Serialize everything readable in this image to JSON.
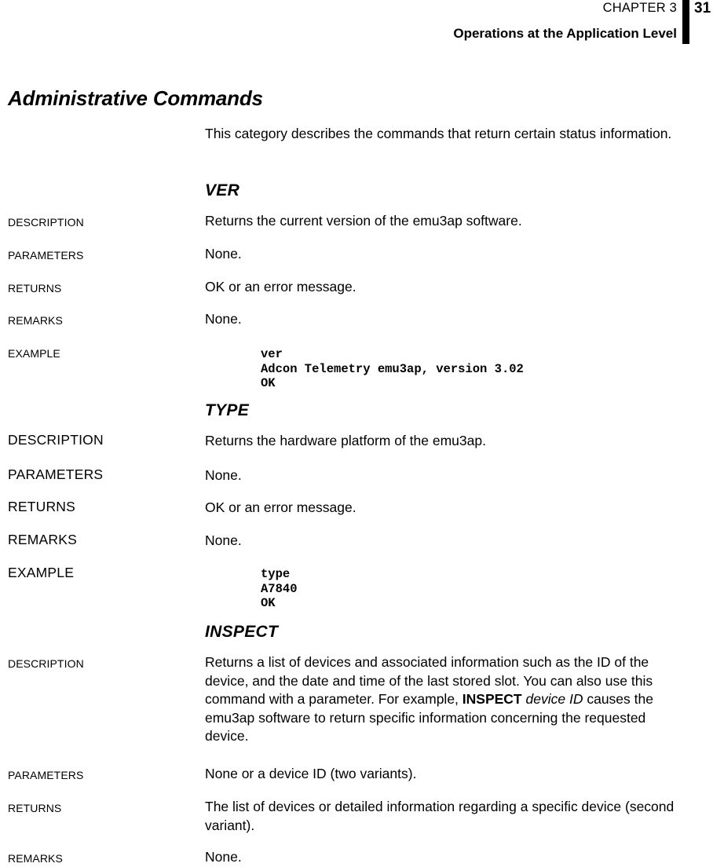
{
  "header": {
    "chapter_label": "CHAPTER 3",
    "page_number": "31",
    "running_title": "Operations at the Application Level"
  },
  "section": {
    "title": "Administrative Commands",
    "intro": "This category describes the commands that return certain status information."
  },
  "commands": [
    {
      "name": "VER",
      "labels": {
        "description": "DESCRIPTION",
        "parameters": "PARAMETERS",
        "returns": "RETURNS",
        "remarks": "REMARKS",
        "example": "EXAMPLE"
      },
      "description": "Returns the current version of the emu3ap software.",
      "parameters": "None.",
      "returns": "OK or an error message.",
      "remarks": "None.",
      "example": "ver\nAdcon Telemetry emu3ap, version 3.02\nOK"
    },
    {
      "name": "TYPE",
      "labels": {
        "description": "DESCRIPTION",
        "parameters": "PARAMETERS",
        "returns": "RETURNS",
        "remarks": "REMARKS",
        "example": "EXAMPLE"
      },
      "description": "Returns the hardware platform of the emu3ap.",
      "parameters": "None.",
      "returns": "OK or an error message.",
      "remarks": "None.",
      "example": "type\nA7840\nOK"
    },
    {
      "name": "INSPECT",
      "labels": {
        "description": "DESCRIPTION",
        "parameters": "PARAMETERS",
        "returns": "RETURNS",
        "remarks": "REMARKS"
      },
      "description_parts": {
        "lead": "Returns a list of devices and associated information such as the ID of the device, and the date and time of the last stored slot. You can also use this command with a parameter. For example, ",
        "bold": "INSPECT",
        "mid": " ",
        "italic": "device ID",
        "tail": " causes the emu3ap software to return specific information concerning the requested device."
      },
      "parameters": "None or a device ID (two variants).",
      "returns": "The list of devices or detailed information regarding a specific device (second variant).",
      "remarks": "None."
    }
  ]
}
